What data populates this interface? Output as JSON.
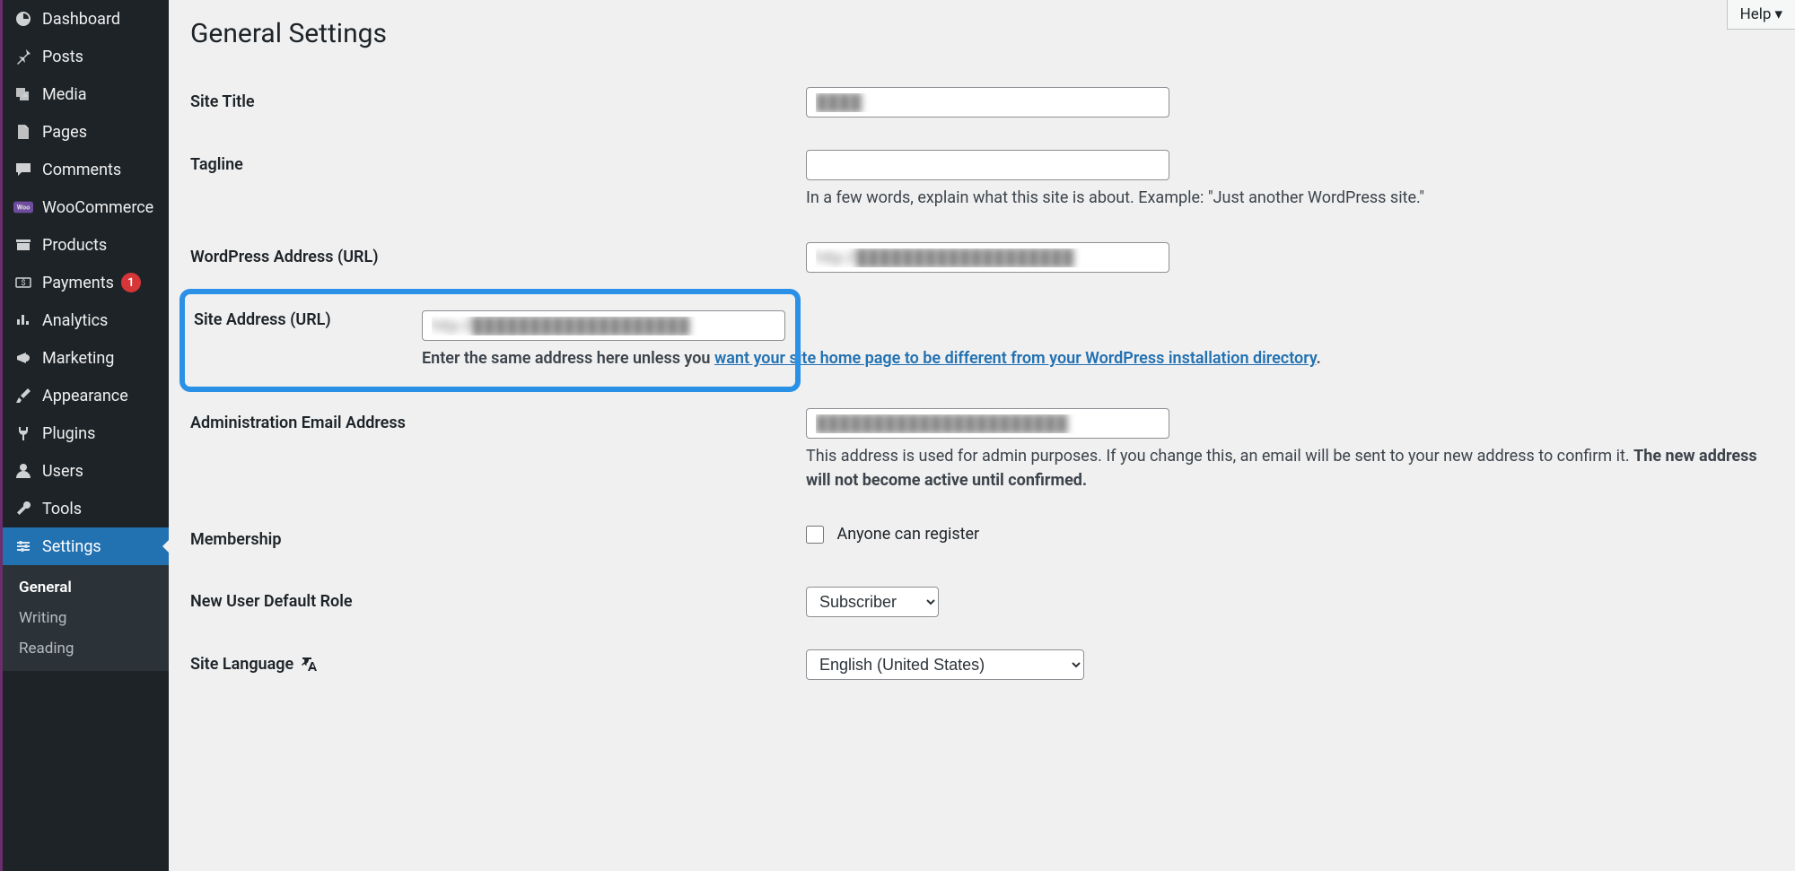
{
  "sidebar": {
    "items": [
      {
        "label": "Dashboard"
      },
      {
        "label": "Posts"
      },
      {
        "label": "Media"
      },
      {
        "label": "Pages"
      },
      {
        "label": "Comments"
      },
      {
        "label": "WooCommerce"
      },
      {
        "label": "Products"
      },
      {
        "label": "Payments",
        "badge": "1"
      },
      {
        "label": "Analytics"
      },
      {
        "label": "Marketing"
      },
      {
        "label": "Appearance"
      },
      {
        "label": "Plugins"
      },
      {
        "label": "Users"
      },
      {
        "label": "Tools"
      },
      {
        "label": "Settings"
      }
    ],
    "submenu": [
      {
        "label": "General"
      },
      {
        "label": "Writing"
      },
      {
        "label": "Reading"
      }
    ]
  },
  "header": {
    "help": "Help",
    "title": "General Settings"
  },
  "form": {
    "site_title": {
      "label": "Site Title",
      "value": "████",
      "placeholder": ""
    },
    "tagline": {
      "label": "Tagline",
      "value": "",
      "description": "In a few words, explain what this site is about. Example: \"Just another WordPress site.\""
    },
    "wp_address": {
      "label": "WordPress Address (URL)",
      "value": "http://███████████████████"
    },
    "site_address": {
      "label": "Site Address (URL)",
      "value": "http://███████████████████",
      "desc_prefix": "Enter the same address here unless you ",
      "desc_link": "want your site home page to be different from your WordPress installation directory",
      "desc_suffix": "."
    },
    "admin_email": {
      "label": "Administration Email Address",
      "value": "██████████████████████",
      "desc_prefix": "This address is used for admin purposes. If you change this, an email will be sent to your new address to confirm it. ",
      "desc_bold": "The new address will not become active until confirmed."
    },
    "membership": {
      "label": "Membership",
      "checkbox_label": "Anyone can register"
    },
    "default_role": {
      "label": "New User Default Role",
      "value": "Subscriber"
    },
    "site_language": {
      "label": "Site Language",
      "value": "English (United States)"
    }
  }
}
